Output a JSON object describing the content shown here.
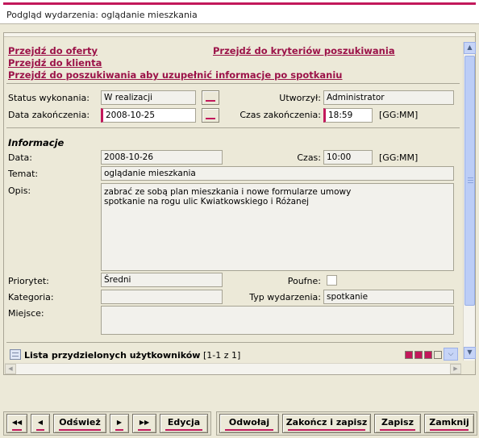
{
  "window": {
    "title": "Podgląd wydarzenia: oglądanie mieszkania"
  },
  "links": {
    "offers": "Przejdź do oferty",
    "criteria": "Przejdź do kryteriów poszukiwania",
    "client": "Przejdź do klienta",
    "search": "Przejdź do poszukiwania aby uzupełnić informacje po spotkaniu"
  },
  "status": {
    "status_label": "Status wykonania:",
    "status_value": "W realizacji",
    "created_by_label": "Utworzył:",
    "created_by_value": "Administrator",
    "end_date_label": "Data zakończenia:",
    "end_date_value": "2008-10-25",
    "end_time_label": "Czas zakończenia:",
    "end_time_value": "18:59",
    "end_time_format": "[GG:MM]"
  },
  "info": {
    "section_title": "Informacje",
    "date_label": "Data:",
    "date_value": "2008-10-26",
    "time_label": "Czas:",
    "time_value": "10:00",
    "time_format": "[GG:MM]",
    "subject_label": "Temat:",
    "subject_value": "oglądanie mieszkania",
    "description_label": "Opis:",
    "description_value": "zabrać ze sobą plan mieszkania i nowe formularze umowy\nspotkanie na rogu ulic Kwiatkowskiego i Różanej",
    "priority_label": "Priorytet:",
    "priority_value": "Średni",
    "confidential_label": "Poufne:",
    "confidential_checked": false,
    "category_label": "Kategoria:",
    "category_value": "",
    "event_type_label": "Typ wydarzenia:",
    "event_type_value": "spotkanie",
    "place_label": "Miejsce:",
    "place_value": ""
  },
  "users_list": {
    "title": "Lista przydzielonych użytkowników",
    "range": "[1-1 z 1]"
  },
  "toolbar": {
    "first": "◀◀",
    "prev": "◀",
    "refresh": "Odśwież",
    "next": "▶",
    "last": "▶▶",
    "edit": "Edycja",
    "cancel": "Odwołaj",
    "finish_save": "Zakończ i zapisz",
    "save": "Zapisz",
    "close": "Zamknij"
  },
  "colors": {
    "accent": "#c2185b",
    "link": "#9b1248",
    "background": "#ece9d8"
  }
}
